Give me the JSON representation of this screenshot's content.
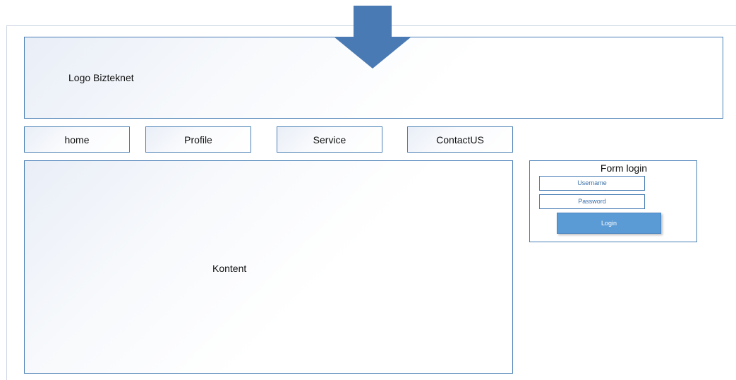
{
  "header": {
    "logo_text": "Logo Bizteknet"
  },
  "nav": {
    "items": [
      {
        "label": "home"
      },
      {
        "label": "Profile"
      },
      {
        "label": "Service"
      },
      {
        "label": "ContactUS"
      }
    ]
  },
  "main": {
    "content_label": "Kontent"
  },
  "login_form": {
    "title": "Form login",
    "username_label": "Username",
    "password_label": "Password",
    "button_label": "Login"
  },
  "colors": {
    "accent": "#4a7fb5",
    "button": "#5b9bd5",
    "arrow": "#4a7ab4"
  },
  "icons": {
    "arrow": "down-arrow-icon"
  }
}
